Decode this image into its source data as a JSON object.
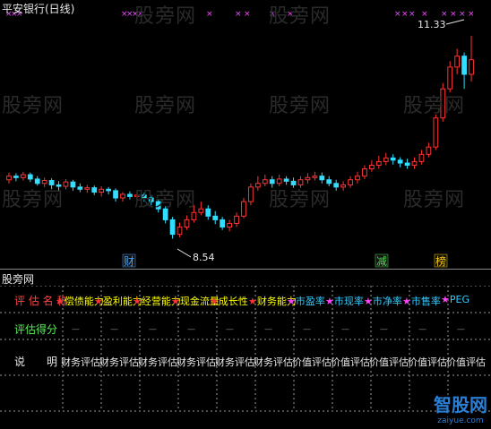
{
  "title": "平安银行(日线)",
  "watermark": "股旁网",
  "chart_data": {
    "type": "candlestick",
    "high_label": "11.33",
    "low_label": "8.54",
    "markers": [
      {
        "label": "财",
        "color": "#4aa3ff"
      },
      {
        "label": "减",
        "color": "#55dd55"
      },
      {
        "label": "榜",
        "color": "#ffcc00"
      }
    ],
    "candles": [
      [
        9.35,
        9.4,
        9.45,
        9.3
      ],
      [
        9.4,
        9.38,
        9.44,
        9.33
      ],
      [
        9.38,
        9.42,
        9.46,
        9.34
      ],
      [
        9.42,
        9.36,
        9.45,
        9.32
      ],
      [
        9.36,
        9.3,
        9.4,
        9.27
      ],
      [
        9.3,
        9.34,
        9.38,
        9.25
      ],
      [
        9.34,
        9.28,
        9.37,
        9.22
      ],
      [
        9.28,
        9.26,
        9.33,
        9.2
      ],
      [
        9.26,
        9.32,
        9.36,
        9.22
      ],
      [
        9.32,
        9.25,
        9.35,
        9.2
      ],
      [
        9.25,
        9.22,
        9.3,
        9.18
      ],
      [
        9.22,
        9.24,
        9.28,
        9.17
      ],
      [
        9.24,
        9.18,
        9.27,
        9.14
      ],
      [
        9.18,
        9.22,
        9.26,
        9.12
      ],
      [
        9.22,
        9.2,
        9.25,
        9.15
      ],
      [
        9.2,
        9.1,
        9.23,
        9.05
      ],
      [
        9.1,
        9.15,
        9.18,
        9.05
      ],
      [
        9.15,
        9.12,
        9.19,
        9.08
      ],
      [
        9.12,
        9.14,
        9.18,
        9.08
      ],
      [
        9.14,
        9.1,
        9.17,
        9.05
      ],
      [
        9.1,
        9.05,
        9.14,
        9.0
      ],
      [
        9.05,
        8.95,
        9.08,
        8.9
      ],
      [
        8.95,
        8.8,
        8.99,
        8.75
      ],
      [
        8.8,
        8.6,
        8.84,
        8.54
      ],
      [
        8.6,
        8.7,
        8.76,
        8.56
      ],
      [
        8.7,
        8.8,
        8.86,
        8.66
      ],
      [
        8.8,
        8.9,
        9.0,
        8.76
      ],
      [
        8.9,
        8.95,
        9.05,
        8.86
      ],
      [
        8.95,
        8.85,
        9.0,
        8.8
      ],
      [
        8.85,
        8.8,
        8.92,
        8.74
      ],
      [
        8.8,
        8.7,
        8.84,
        8.66
      ],
      [
        8.7,
        8.75,
        8.8,
        8.64
      ],
      [
        8.75,
        8.85,
        8.9,
        8.7
      ],
      [
        8.85,
        9.05,
        9.1,
        8.82
      ],
      [
        9.05,
        9.25,
        9.3,
        9.0
      ],
      [
        9.25,
        9.3,
        9.4,
        9.2
      ],
      [
        9.3,
        9.35,
        9.42,
        9.26
      ],
      [
        9.35,
        9.3,
        9.4,
        9.24
      ],
      [
        9.3,
        9.36,
        9.42,
        9.26
      ],
      [
        9.36,
        9.33,
        9.4,
        9.28
      ],
      [
        9.33,
        9.28,
        9.38,
        9.24
      ],
      [
        9.28,
        9.35,
        9.4,
        9.24
      ],
      [
        9.35,
        9.38,
        9.44,
        9.3
      ],
      [
        9.38,
        9.4,
        9.46,
        9.34
      ],
      [
        9.4,
        9.35,
        9.45,
        9.3
      ],
      [
        9.35,
        9.3,
        9.4,
        9.26
      ],
      [
        9.3,
        9.25,
        9.35,
        9.2
      ],
      [
        9.25,
        9.28,
        9.33,
        9.2
      ],
      [
        9.28,
        9.35,
        9.4,
        9.24
      ],
      [
        9.35,
        9.4,
        9.46,
        9.3
      ],
      [
        9.4,
        9.5,
        9.55,
        9.36
      ],
      [
        9.5,
        9.55,
        9.62,
        9.46
      ],
      [
        9.55,
        9.6,
        9.68,
        9.5
      ],
      [
        9.6,
        9.65,
        9.72,
        9.55
      ],
      [
        9.65,
        9.62,
        9.7,
        9.56
      ],
      [
        9.62,
        9.58,
        9.66,
        9.52
      ],
      [
        9.58,
        9.55,
        9.64,
        9.5
      ],
      [
        9.55,
        9.6,
        9.66,
        9.5
      ],
      [
        9.6,
        9.7,
        9.76,
        9.56
      ],
      [
        9.7,
        9.8,
        9.86,
        9.66
      ],
      [
        9.8,
        10.2,
        10.25,
        9.76
      ],
      [
        10.2,
        10.6,
        10.68,
        10.15
      ],
      [
        10.6,
        10.9,
        10.98,
        10.55
      ],
      [
        10.9,
        11.05,
        11.15,
        10.8
      ],
      [
        11.05,
        10.8,
        11.1,
        10.6
      ],
      [
        10.8,
        11.0,
        11.33,
        10.7
      ]
    ]
  },
  "bottom": {
    "title": "股旁网",
    "row1_label": "评 估 名 称",
    "row1_items": [
      {
        "text": "偿债能力",
        "star": "#ff3333",
        "color": "#ffff00"
      },
      {
        "text": "盈利能力",
        "star": "#ff3333",
        "color": "#ffff00"
      },
      {
        "text": "经营能力",
        "star": "#ff3333",
        "color": "#ffff00"
      },
      {
        "text": "现金流量",
        "star": "#ff3333",
        "color": "#ffff00"
      },
      {
        "text": "成长性",
        "star": "#ff3333",
        "color": "#ffff00"
      },
      {
        "text": "财务能力",
        "star": "#ff3333",
        "color": "#ffff00"
      },
      {
        "text": "市盈率",
        "star": "#ff44ff",
        "color": "#33ccff"
      },
      {
        "text": "市现率",
        "star": "#ff44ff",
        "color": "#33ccff"
      },
      {
        "text": "市净率",
        "star": "#ff44ff",
        "color": "#33ccff"
      },
      {
        "text": "市售率",
        "star": "#ff44ff",
        "color": "#33ccff"
      },
      {
        "text": "PEG",
        "star": "#ff44ff",
        "color": "#33ccff"
      }
    ],
    "row2_label": "评估得分",
    "row3_label": "说　　明",
    "row3_items": [
      "财务评估",
      "财务评估",
      "财务评估",
      "财务评估",
      "财务评估",
      "财务评估",
      "价值评估",
      "价值评估",
      "价值评估",
      "价值评估",
      "价值评估"
    ]
  },
  "brand": {
    "name": "智股网",
    "url": "zaiyue.com"
  }
}
